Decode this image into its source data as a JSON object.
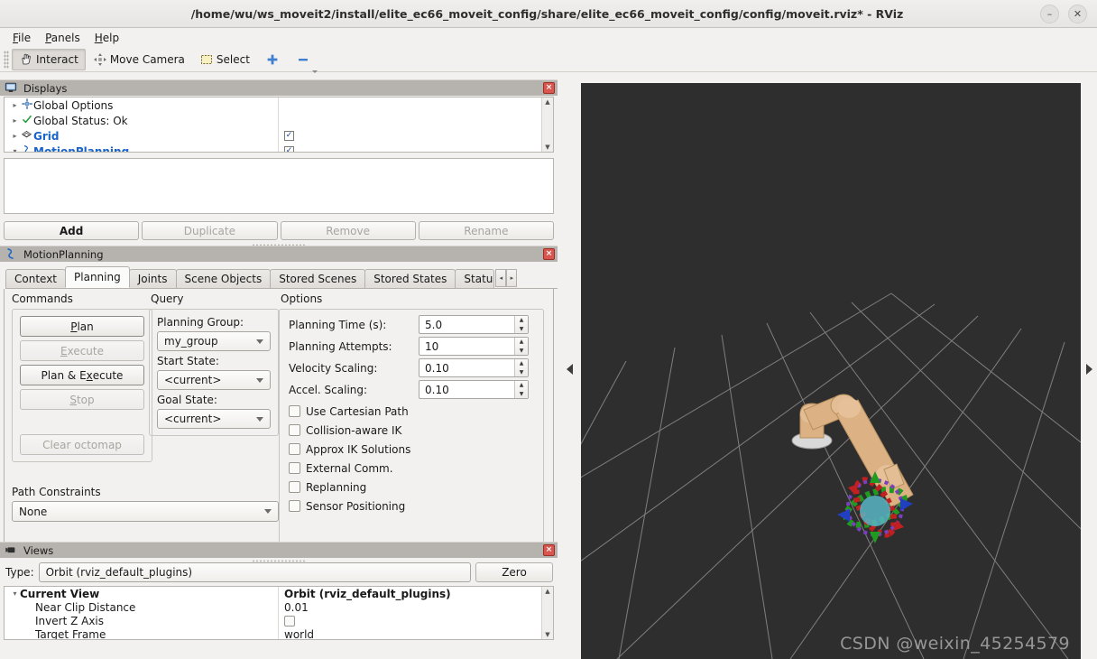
{
  "window": {
    "title": "/home/wu/ws_moveit2/install/elite_ec66_moveit_config/share/elite_ec66_moveit_config/config/moveit.rviz* - RViz",
    "minimize_label": "–",
    "close_label": "✕"
  },
  "menubar": {
    "items": [
      "File",
      "Panels",
      "Help"
    ]
  },
  "toolbar": {
    "interact_label": "Interact",
    "move_camera_label": "Move Camera",
    "select_label": "Select",
    "plus_label": "+",
    "minus_label": "−"
  },
  "displays_panel": {
    "title": "Displays",
    "close_label": "×",
    "rows": [
      {
        "label": "Global Options",
        "icon": "gear-icon",
        "twisty": "▸",
        "checked": null,
        "color": "black"
      },
      {
        "label": "Global Status: Ok",
        "icon": "check-icon",
        "twisty": "▸",
        "checked": null,
        "color": "black"
      },
      {
        "label": "Grid",
        "icon": "grid-icon",
        "twisty": "▸",
        "checked": true,
        "color": "blue"
      },
      {
        "label": "MotionPlanning",
        "icon": "motion-icon",
        "twisty": "▾",
        "checked": true,
        "color": "blue"
      }
    ],
    "buttons": [
      {
        "label": "Add",
        "enabled": true
      },
      {
        "label": "Duplicate",
        "enabled": false
      },
      {
        "label": "Remove",
        "enabled": false
      },
      {
        "label": "Rename",
        "enabled": false
      }
    ]
  },
  "motion_planning": {
    "title": "MotionPlanning",
    "close_label": "×",
    "tabs": [
      {
        "label": "Context",
        "selected": false
      },
      {
        "label": "Planning",
        "selected": true
      },
      {
        "label": "Joints",
        "selected": false
      },
      {
        "label": "Scene Objects",
        "selected": false
      },
      {
        "label": "Stored Scenes",
        "selected": false
      },
      {
        "label": "Stored States",
        "selected": false
      },
      {
        "label": "Status",
        "selected": false
      }
    ],
    "tab_scroll_left": "◂",
    "tab_scroll_right": "▸",
    "commands": {
      "header": "Commands",
      "buttons": [
        {
          "label": "Plan",
          "enabled": true,
          "mnemonic": "P"
        },
        {
          "label": "Execute",
          "enabled": false,
          "mnemonic": "E"
        },
        {
          "label": "Plan & Execute",
          "enabled": true,
          "mnemonic": "x"
        },
        {
          "label": "Stop",
          "enabled": false,
          "mnemonic": "S"
        },
        {
          "label": "",
          "enabled": true,
          "spacer": true
        },
        {
          "label": "Clear octomap",
          "enabled": false,
          "mnemonic": ""
        }
      ]
    },
    "query": {
      "header": "Query",
      "planning_group_label": "Planning Group:",
      "planning_group_value": "my_group",
      "start_state_label": "Start State:",
      "start_state_value": "<current>",
      "goal_state_label": "Goal State:",
      "goal_state_value": "<current>"
    },
    "path_constraints": {
      "header": "Path Constraints",
      "value": "None"
    },
    "options": {
      "header": "Options",
      "fields": [
        {
          "label": "Planning Time (s):",
          "value": "5.0"
        },
        {
          "label": "Planning Attempts:",
          "value": "10"
        },
        {
          "label": "Velocity Scaling:",
          "value": "0.10"
        },
        {
          "label": "Accel. Scaling:",
          "value": "0.10"
        }
      ],
      "checkboxes": [
        {
          "label": "Use Cartesian Path",
          "checked": false
        },
        {
          "label": "Collision-aware IK",
          "checked": false
        },
        {
          "label": "Approx IK Solutions",
          "checked": false
        },
        {
          "label": "External Comm.",
          "checked": false
        },
        {
          "label": "Replanning",
          "checked": false
        },
        {
          "label": "Sensor Positioning",
          "checked": false
        }
      ]
    }
  },
  "views_panel": {
    "title": "Views",
    "close_label": "×",
    "type_label": "Type:",
    "type_value": "Orbit (rviz_default_plugins)",
    "zero_button": "Zero",
    "tree": [
      {
        "name": "Current View",
        "value": "Orbit (rviz_default_plugins)",
        "head": true,
        "twisty": "▾",
        "kind": "text"
      },
      {
        "name": "Near Clip Distance",
        "value": "0.01",
        "head": false,
        "kind": "text"
      },
      {
        "name": "Invert Z Axis",
        "value": "",
        "head": false,
        "kind": "checkbox"
      },
      {
        "name": "Target Frame",
        "value": "world",
        "head": false,
        "kind": "text"
      }
    ]
  },
  "viewport": {
    "background_color": "#2e2e2e",
    "grid_color": "#9a9a9a",
    "robot_color": "#d9ae7e",
    "watermark": "CSDN @weixin_45254579",
    "collapse_left_arrow": "▸",
    "collapse_right_arrow": "◂"
  }
}
